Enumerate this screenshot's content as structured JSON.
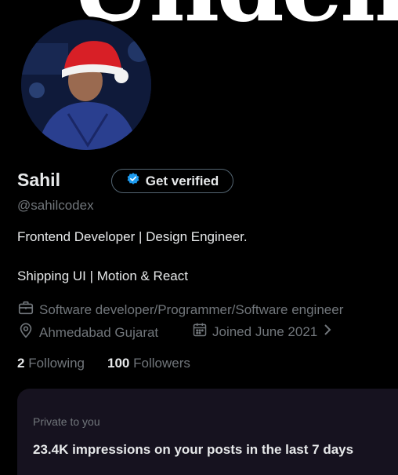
{
  "banner": {
    "text": "Undemai"
  },
  "profile": {
    "name": "Sahil",
    "verify_label": "Get verified",
    "handle": "@sahilcodex",
    "bio_line1": "Frontend Developer | Design Engineer.",
    "bio_line2": "Shipping UI | Motion & React",
    "profession": "Software developer/Programmer/Software engineer",
    "location": "Ahmedabad Gujarat",
    "joined": "Joined June 2021",
    "following_count": "2",
    "following_label": "Following",
    "followers_count": "100",
    "followers_label": "Followers"
  },
  "insights": {
    "label": "Private to you",
    "text": "23.4K impressions on your posts in the last 7 days"
  },
  "icons": {
    "verified": "verified-badge-icon",
    "briefcase": "briefcase-icon",
    "location": "location-pin-icon",
    "calendar": "calendar-icon",
    "chevron": "chevron-right-icon"
  },
  "colors": {
    "background": "#000000",
    "verified": "#1d9bf0",
    "secondary_text": "#71767b",
    "card": "#16121f"
  }
}
